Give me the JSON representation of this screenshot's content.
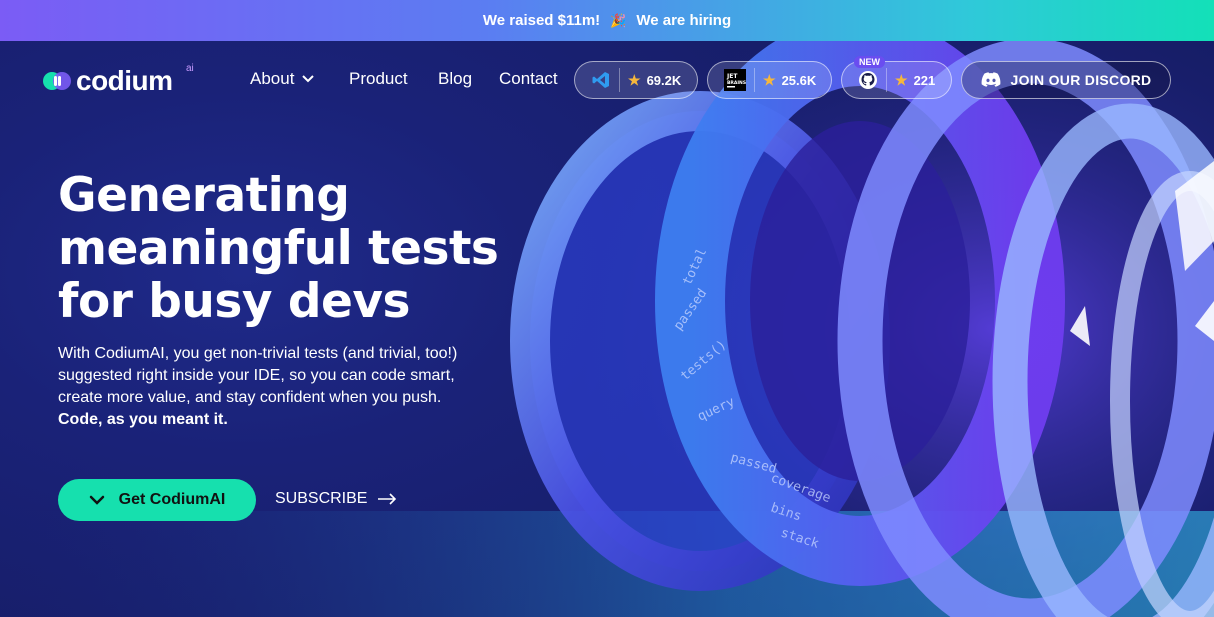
{
  "banner": {
    "raised": "We raised $11m!",
    "party_icon": "party-popper-icon",
    "hiring": "We are hiring"
  },
  "logo": {
    "word": "codium",
    "superscript": "ai"
  },
  "nav": {
    "about": "About",
    "product": "Product",
    "blog": "Blog",
    "contact": "Contact"
  },
  "stats": {
    "vscode_count": "69.2K",
    "jetbrains_count": "25.6K",
    "jetbrains_logo_text": "JET\nBRAINS",
    "github_badge": "NEW",
    "github_count": "221"
  },
  "discord": {
    "label": "JOIN OUR DISCORD"
  },
  "hero": {
    "headline_line1": "Generating",
    "headline_line2": "meaningful tests",
    "headline_line3": "for busy devs",
    "sub_line1": "With CodiumAI, you get non-trivial tests (and trivial, too!)",
    "sub_line2": "suggested right inside your IDE, so you can code smart,",
    "sub_line3": "create more value, and stay confident when you push.",
    "sub_line4": "Code, as you meant it.",
    "cta_label": "Get CodiumAI",
    "subscribe_label": "SUBSCRIBE",
    "art_words": [
      "total",
      "passed",
      "tests()",
      "query",
      "passed",
      "coverage",
      "bins",
      "stack"
    ]
  },
  "colors": {
    "accent": "#16e0ae",
    "brand_purple": "#7b5cf5",
    "star": "#f6b73c"
  }
}
